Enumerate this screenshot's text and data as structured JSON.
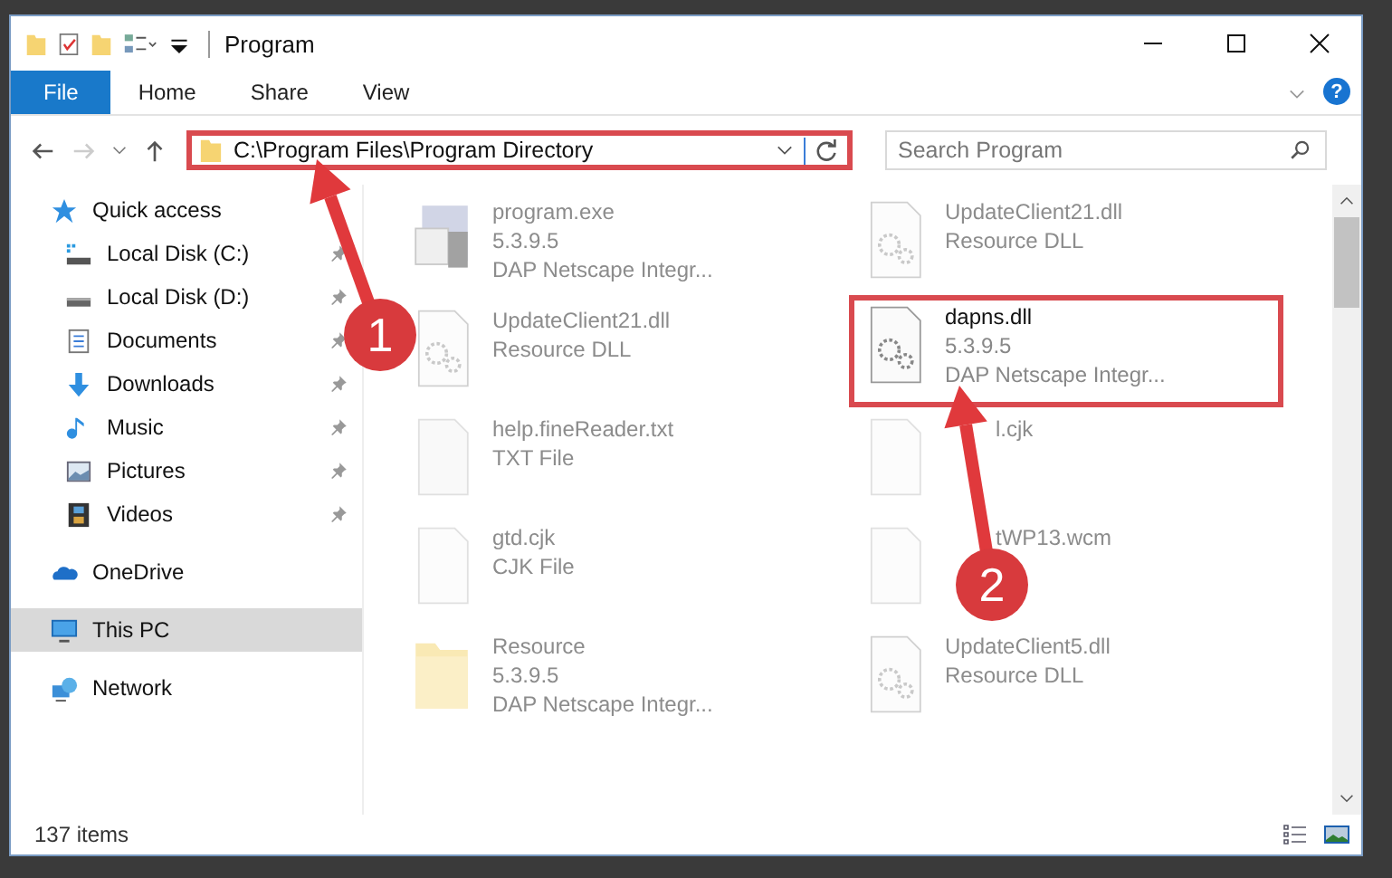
{
  "window": {
    "title": "Program"
  },
  "ribbon": {
    "help_button": "?",
    "tabs": [
      {
        "label": "File",
        "selected": true
      },
      {
        "label": "Home",
        "selected": false
      },
      {
        "label": "Share",
        "selected": false
      },
      {
        "label": "View",
        "selected": false
      }
    ]
  },
  "address_bar": {
    "path": "C:\\Program Files\\Program Directory",
    "highlighted": true
  },
  "search": {
    "placeholder": "Search Program"
  },
  "sidebar": {
    "items": [
      {
        "label": "Quick access",
        "kind": "star",
        "pinned": false,
        "selected": false,
        "children": [
          {
            "label": "Local Disk (C:)",
            "kind": "disk-c",
            "pinned": true,
            "selected": false
          },
          {
            "label": "Local Disk (D:)",
            "kind": "disk",
            "pinned": true,
            "selected": false
          },
          {
            "label": "Documents",
            "kind": "docs",
            "pinned": true,
            "selected": false
          },
          {
            "label": "Downloads",
            "kind": "down",
            "pinned": true,
            "selected": false
          },
          {
            "label": "Music",
            "kind": "music",
            "pinned": true,
            "selected": false
          },
          {
            "label": "Pictures",
            "kind": "pics",
            "pinned": true,
            "selected": false
          },
          {
            "label": "Videos",
            "kind": "video",
            "pinned": true,
            "selected": false
          }
        ]
      },
      {
        "label": "OneDrive",
        "kind": "cloud",
        "pinned": false,
        "selected": false
      },
      {
        "label": "This PC",
        "kind": "pc",
        "pinned": false,
        "selected": true
      },
      {
        "label": "Network",
        "kind": "net",
        "pinned": false,
        "selected": false
      }
    ]
  },
  "files": [
    {
      "kind": "exe",
      "lines": [
        "program.exe",
        "5.3.9.5",
        "DAP Netscape Integr..."
      ],
      "dimmed": true,
      "highlighted": false
    },
    {
      "kind": "dll",
      "lines": [
        "UpdateClient21.dll",
        "Resource DLL"
      ],
      "dimmed": true,
      "highlighted": false
    },
    {
      "kind": "dll",
      "lines": [
        "UpdateClient21.dll",
        "Resource DLL"
      ],
      "dimmed": true,
      "highlighted": false
    },
    {
      "kind": "dll",
      "lines": [
        "dapns.dll",
        "5.3.9.5",
        "DAP Netscape Integr..."
      ],
      "dimmed": false,
      "highlighted": true
    },
    {
      "kind": "txt",
      "lines": [
        "help.fineReader.txt",
        "TXT File"
      ],
      "dimmed": true,
      "highlighted": false
    },
    {
      "kind": "file",
      "lines": [
        "l.cjk"
      ],
      "dimmed": true,
      "highlighted": false,
      "covered": true
    },
    {
      "kind": "file",
      "lines": [
        "gtd.cjk",
        "CJK File"
      ],
      "dimmed": true,
      "highlighted": false
    },
    {
      "kind": "file",
      "lines": [
        "tWP13.wcm"
      ],
      "dimmed": true,
      "highlighted": false,
      "covered": true
    },
    {
      "kind": "folder",
      "lines": [
        "Resource",
        "5.3.9.5",
        "DAP Netscape Integr..."
      ],
      "dimmed": true,
      "highlighted": false
    },
    {
      "kind": "dll",
      "lines": [
        "UpdateClient5.dll",
        "Resource DLL"
      ],
      "dimmed": true,
      "highlighted": false
    }
  ],
  "status_bar": {
    "count": "137 items"
  },
  "annotations": [
    {
      "label": "1"
    },
    {
      "label": "2"
    }
  ]
}
